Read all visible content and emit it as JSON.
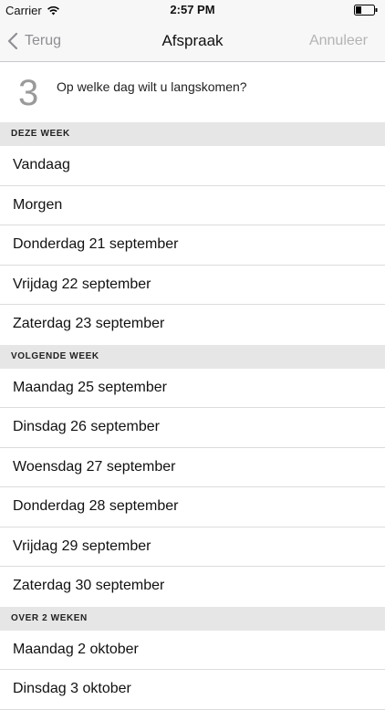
{
  "status_bar": {
    "carrier": "Carrier",
    "wifi_icon": "wifi-icon",
    "time": "2:57 PM",
    "battery_icon": "battery-icon"
  },
  "nav": {
    "back_label": "Terug",
    "back_icon": "chevron-left-icon",
    "title": "Afspraak",
    "cancel_label": "Annuleer"
  },
  "question": {
    "step": "3",
    "text": "Op welke dag wilt u langskomen?"
  },
  "sections": [
    {
      "header": "DEZE WEEK",
      "items": [
        "Vandaag",
        "Morgen",
        "Donderdag 21 september",
        "Vrijdag 22 september",
        "Zaterdag 23 september"
      ]
    },
    {
      "header": "VOLGENDE WEEK",
      "items": [
        "Maandag 25 september",
        "Dinsdag 26 september",
        "Woensdag 27 september",
        "Donderdag 28 september",
        "Vrijdag 29 september",
        "Zaterdag 30 september"
      ]
    },
    {
      "header": "OVER 2 WEKEN",
      "items": [
        "Maandag 2 oktober",
        "Dinsdag 3 oktober"
      ]
    }
  ],
  "colors": {
    "nav_background": "#f7f7f7",
    "section_header_background": "#e6e6e6",
    "nav_button_text": "#8e8e93",
    "cancel_text": "#b3b3b3",
    "step_number": "#9a9a9a"
  }
}
